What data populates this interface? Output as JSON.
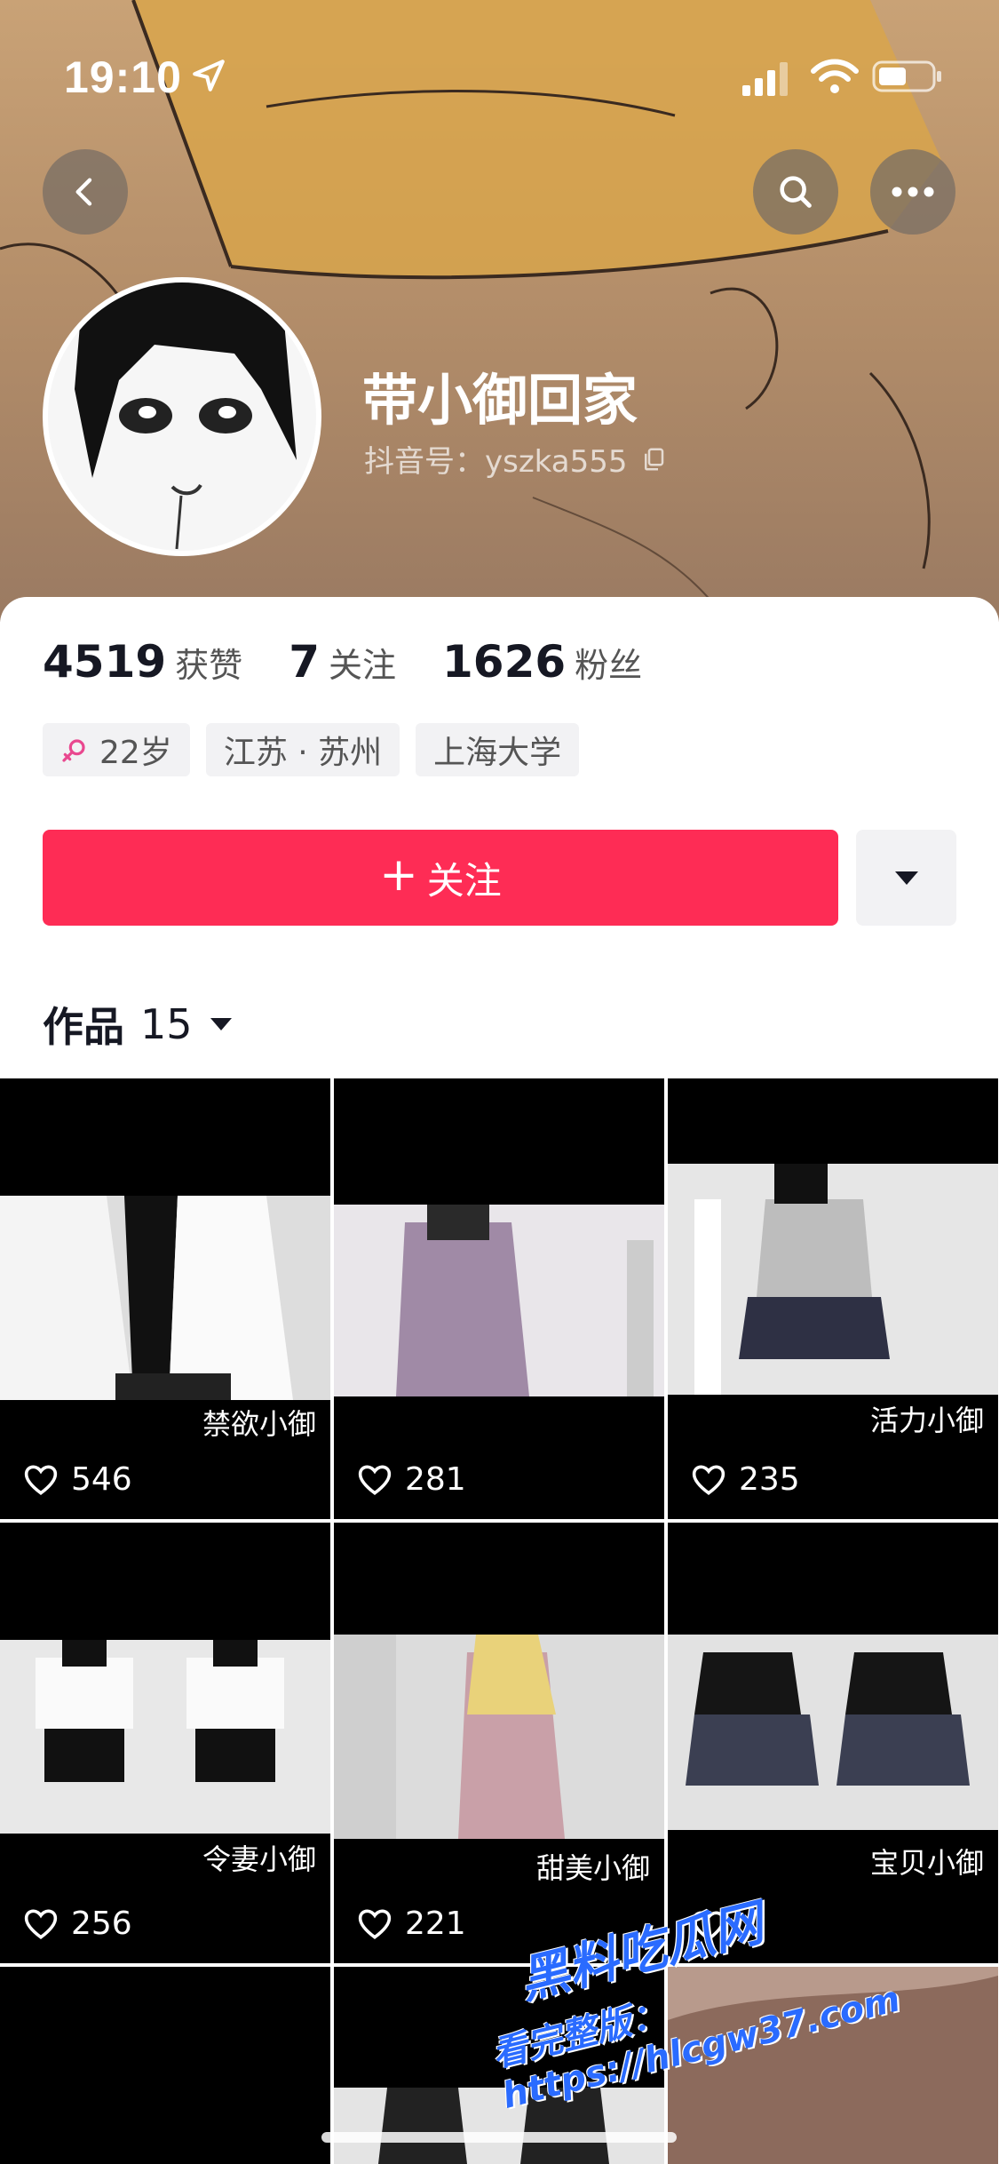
{
  "status_bar": {
    "time": "19:10"
  },
  "profile": {
    "name": "带小御回家",
    "douyin_id": "抖音号：yszka555",
    "stats": [
      {
        "num": "4519",
        "label": "获赞"
      },
      {
        "num": "7",
        "label": "关注"
      },
      {
        "num": "1626",
        "label": "粉丝"
      }
    ],
    "tags": {
      "age": "22岁",
      "location": "江苏 · 苏州",
      "school": "上海大学"
    },
    "follow_label": "关注",
    "follow_plus": "+"
  },
  "works": {
    "label": "作品",
    "count": "15"
  },
  "grid": [
    {
      "caption": "禁欲小御",
      "likes": "546"
    },
    {
      "caption": "",
      "likes": "281"
    },
    {
      "caption": "活力小御",
      "likes": "235"
    },
    {
      "caption": "令妻小御",
      "likes": "256"
    },
    {
      "caption": "甜美小御",
      "likes": "221"
    },
    {
      "caption": "宝贝小御",
      "likes": ""
    }
  ],
  "watermark": {
    "line1": "黑料吃瓜网",
    "line2": "看完整版：https://hlcgw37.com"
  },
  "colors": {
    "accent": "#fe2c55",
    "gender": "#e9488f"
  }
}
